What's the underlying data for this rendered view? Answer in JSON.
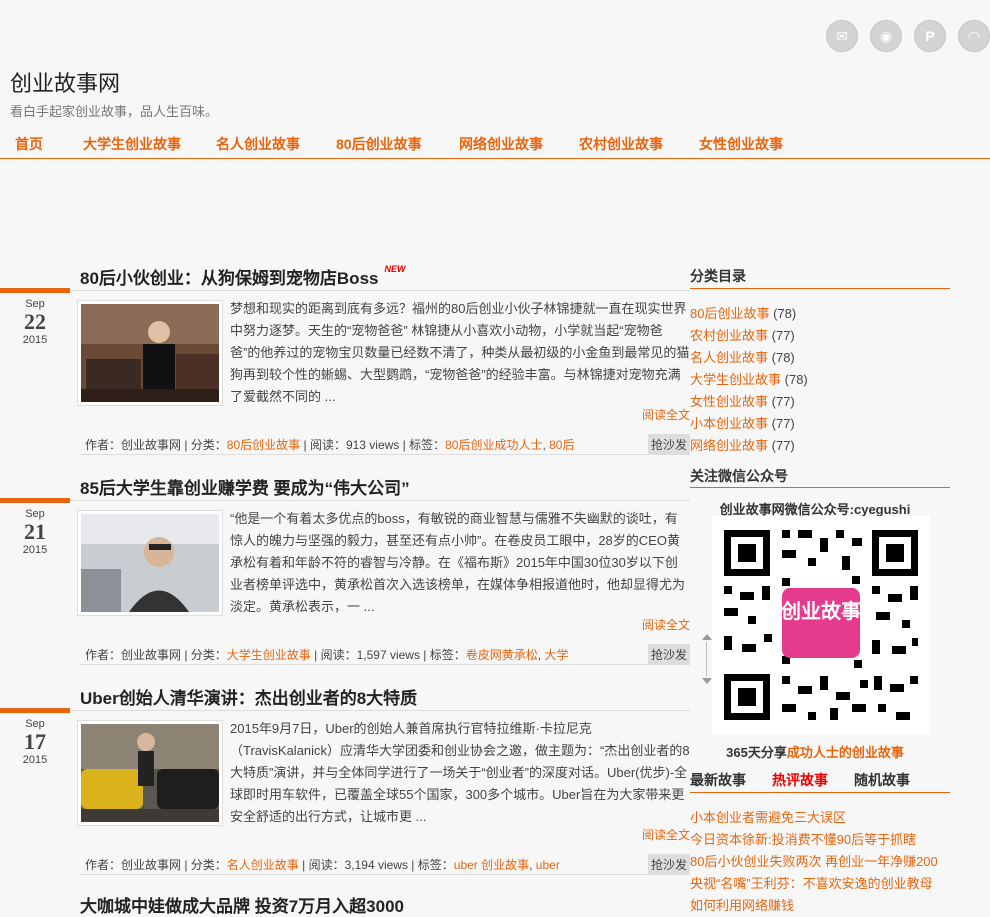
{
  "site": {
    "title": "创业故事网",
    "description": "看白手起家创业故事，品人生百味。"
  },
  "social": [
    "email-icon",
    "weibo-icon",
    "pinterest-icon",
    "rss-icon"
  ],
  "nav": [
    "首页",
    "大学生创业故事",
    "名人创业故事",
    "80后创业故事",
    "网络创业故事",
    "农村创业故事",
    "女性创业故事"
  ],
  "posts": [
    {
      "title": "80后小伙创业：从狗保姆到宠物店Boss",
      "new": "NEW",
      "month": "Sep",
      "day": "22",
      "year": "2015",
      "excerpt": "梦想和现实的距离到底有多远？福州的80后创业小伙子林锦捷就一直在现实世界中努力逐梦。天生的“宠物爸爸” 林锦捷从小喜欢小动物，小学就当起“宠物爸爸”的他养过的宠物宝贝数量已经数不清了，种类从最初级的小金鱼到最常见的猫狗再到较个性的蜥蜴、大型鹦鹉，“宠物爸爸”的经验丰富。与林锦捷对宠物充满了爱截然不同的 ...",
      "more": "阅读全文",
      "meta_author": "作者：创业故事网 | 分类：",
      "category": "80后创业故事",
      "meta_views": " | 阅读：913 views | 标签：",
      "tags": [
        "80后创业成功人士",
        "80后"
      ],
      "sofa": "抢沙发"
    },
    {
      "title": "85后大学生靠创业赚学费 要成为“伟大公司”",
      "new": "",
      "month": "Sep",
      "day": "21",
      "year": "2015",
      "excerpt": "“他是一个有着太多优点的boss，有敏锐的商业智慧与儒雅不失幽默的谈吐，有惊人的魄力与坚强的毅力，甚至还有点小帅”。在卷皮员工眼中，28岁的CEO黄承松有着和年龄不符的睿智与冷静。在《福布斯》2015年中国30位30岁以下创业者榜单评选中，黄承松首次入选该榜单，在媒体争相报道他时，他却显得尤为淡定。黄承松表示，一 ...",
      "more": "阅读全文",
      "meta_author": "作者：创业故事网 | 分类：",
      "category": "大学生创业故事",
      "meta_views": " | 阅读：1,597 views | 标签：",
      "tags": [
        "卷皮网黄承松",
        "大学"
      ],
      "sofa": "抢沙发"
    },
    {
      "title": "Uber创始人清华演讲：杰出创业者的8大特质",
      "new": "",
      "month": "Sep",
      "day": "17",
      "year": "2015",
      "excerpt": "2015年9月7日，Uber的创始人兼首席执行官特拉维斯·卡拉尼克（TravisKalanick）应清华大学团委和创业协会之邀，做主题为：“杰出创业者的8大特质”演讲，并与全体同学进行了一场关于“创业者”的深度对话。Uber(优步)-全球即时用车软件，已覆盖全球55个国家，300多个城市。Uber旨在为大家带来更安全舒适的出行方式，让城市更 ...",
      "more": "阅读全文",
      "meta_author": "作者：创业故事网 | 分类：",
      "category": "名人创业故事",
      "meta_views": " | 阅读：3,194 views | 标签：",
      "tags": [
        "uber 创业故事",
        "uber"
      ],
      "sofa": "抢沙发"
    }
  ],
  "next_post_title": "大咖城中娃做成大品牌 投资7万月入超3000",
  "sidebar": {
    "category_title": "分类目录",
    "categories": [
      {
        "name": "80后创业故事",
        "count": "(78)"
      },
      {
        "name": "农村创业故事",
        "count": "(77)"
      },
      {
        "name": "名人创业故事",
        "count": "(78)"
      },
      {
        "name": "大学生创业故事",
        "count": "(78)"
      },
      {
        "name": "女性创业故事",
        "count": "(77)"
      },
      {
        "name": "小本创业故事",
        "count": "(77)"
      },
      {
        "name": "网络创业故事",
        "count": "(77)"
      }
    ],
    "wechat_title": "关注微信公众号",
    "wechat_caption": "创业故事网微信公众号:cyegushi",
    "qr_text": "创业故事",
    "share_prefix": "365天分享",
    "share_highlight": "成功人士的创业故事",
    "tabs": [
      "最新故事",
      "热评故事",
      "随机故事"
    ],
    "latest": [
      "小本创业者需避免三大误区",
      "今日资本徐新:投消费不懂90后等于抓瞎",
      "80后小伙创业失败两次 再创业一年净赚200",
      "央视“名嘴”王利芬：不喜欢安逸的创业教母",
      "如何利用网络赚钱"
    ]
  },
  "colors": {
    "accent": "#e8650d",
    "background": "#f7f7f7"
  }
}
